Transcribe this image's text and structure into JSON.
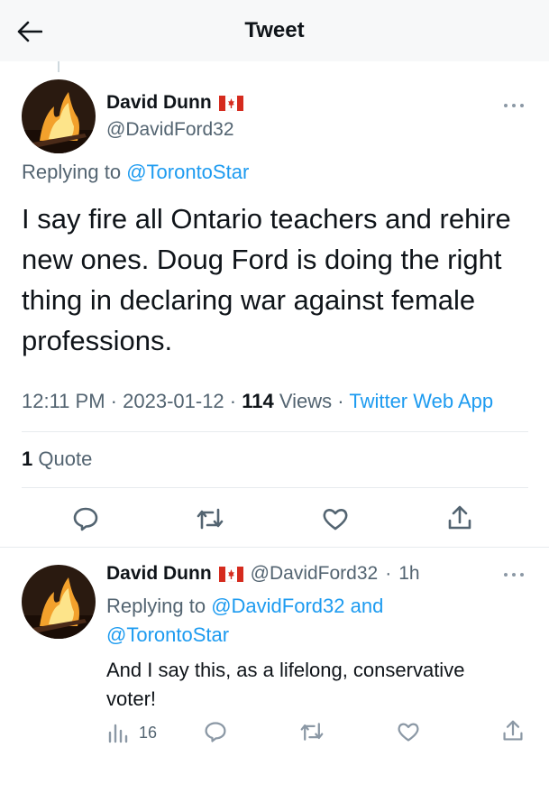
{
  "header": {
    "title": "Tweet",
    "back_icon": "arrow-left-icon"
  },
  "tweet": {
    "author_name": "David Dunn",
    "flag_icon": "canada-flag-icon",
    "handle": "@DavidFord32",
    "replying_prefix": "Replying to",
    "replying_to": "@TorontoStar",
    "text": "I say fire all Ontario teachers and rehire new ones. Doug Ford is doing the right thing in declaring war against female professions.",
    "time": "12:11 PM",
    "date": "2023-01-12",
    "views_count": "114",
    "views_label": "Views",
    "source": "Twitter Web App",
    "quote_count": "1",
    "quote_label": "Quote",
    "sep": "·"
  },
  "reply": {
    "author_name": "David Dunn",
    "handle": "@DavidFord32",
    "age": "1h",
    "replying_prefix": "Replying to",
    "replying_to_1": "@DavidFord32",
    "and_word": "and",
    "replying_to_2": "@TorontoStar",
    "text": "And I say this, as a lifelong, conservative voter!",
    "views_count": "16",
    "sep": "·"
  },
  "colors": {
    "accent": "#1d9bf0",
    "muted": "#536471",
    "text": "#0f1419",
    "divider": "#e7ebee"
  }
}
